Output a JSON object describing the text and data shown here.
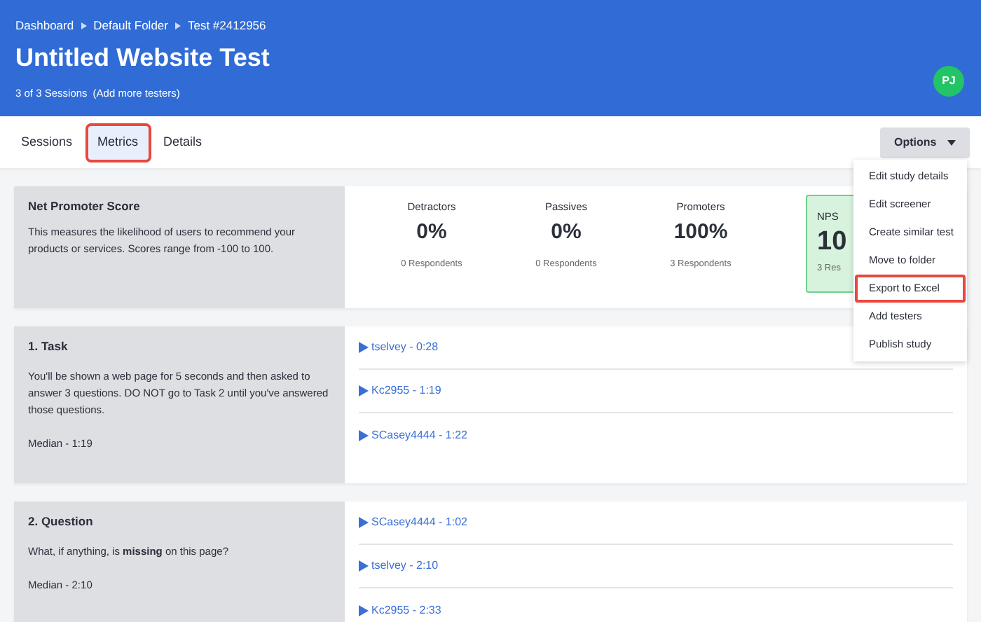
{
  "breadcrumbs": [
    "Dashboard",
    "Default Folder",
    "Test #2412956"
  ],
  "title": "Untitled Website Test",
  "sessions": "3 of 3 Sessions",
  "add_testers_link": "(Add more testers)",
  "avatar": {
    "initials": "PJ"
  },
  "tabs": [
    {
      "label": "Sessions",
      "selected": false,
      "highlighted": false
    },
    {
      "label": "Metrics",
      "selected": true,
      "highlighted": true
    },
    {
      "label": "Details",
      "selected": false,
      "highlighted": false
    }
  ],
  "options_button": {
    "label": "Options",
    "expanded": true
  },
  "options_menu": [
    {
      "label": "Edit study details",
      "highlighted": false
    },
    {
      "label": "Edit screener",
      "highlighted": false
    },
    {
      "label": "Create similar test",
      "highlighted": false
    },
    {
      "label": "Move to folder",
      "highlighted": false
    },
    {
      "label": "Export to Excel",
      "highlighted": true
    },
    {
      "label": "Add testers",
      "highlighted": false
    },
    {
      "label": "Publish study",
      "highlighted": false
    }
  ],
  "nps": {
    "title": "Net Promoter Score",
    "description": "This measures the likelihood of users to recommend your products or services. Scores range from -100 to 100.",
    "stats": [
      {
        "label": "Detractors",
        "value": "0%",
        "respondents": "0 Respondents"
      },
      {
        "label": "Passives",
        "value": "0%",
        "respondents": "0 Respondents"
      },
      {
        "label": "Promoters",
        "value": "100%",
        "respondents": "3 Respondents"
      }
    ],
    "score": {
      "label": "NPS",
      "value": "10",
      "respondents": "3 Res"
    }
  },
  "sections": [
    {
      "title": "1. Task",
      "description": "You'll be shown a web page for 5 seconds and then asked to answer 3 questions. DO NOT go to Task 2 until you've answered those questions.",
      "median": "Median - 1:19",
      "sessions": [
        "tselvey - 0:28",
        "Kc2955 - 1:19",
        "SCasey4444 - 1:22"
      ]
    },
    {
      "title": "2. Question",
      "description": "What, if anything, is **missing** on this page?",
      "median": "Median - 2:10",
      "sessions": [
        "SCasey4444 - 1:02",
        "tselvey - 2:10",
        "Kc2955 - 2:33"
      ]
    }
  ]
}
